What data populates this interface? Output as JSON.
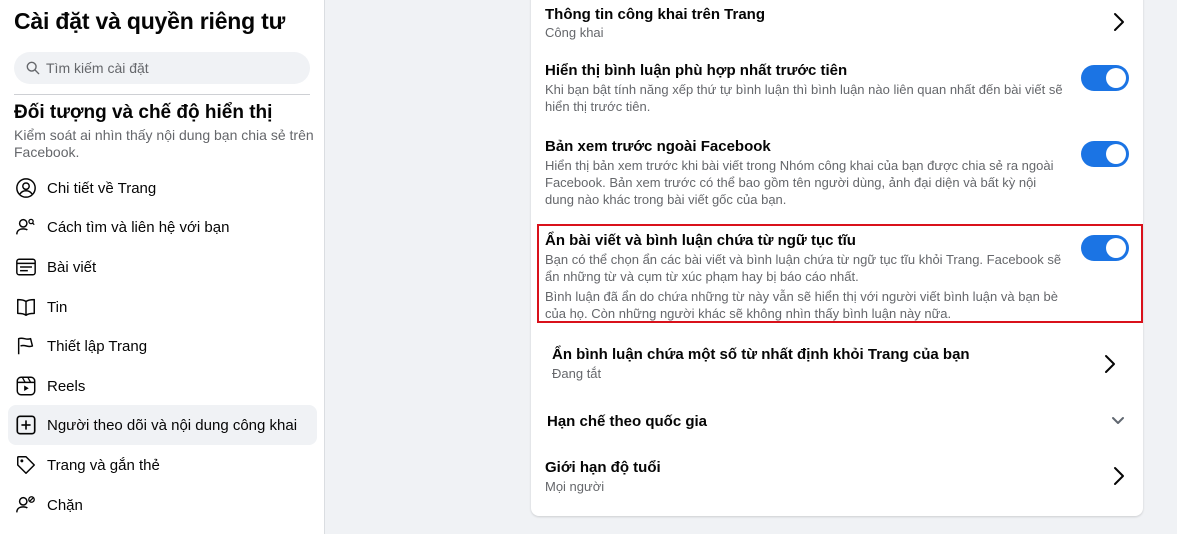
{
  "sidebar": {
    "title": "Cài đặt và quyền riêng tư",
    "search_placeholder": "Tìm kiếm cài đặt",
    "section_title": "Đối tượng và chế độ hiển thị",
    "section_desc": "Kiểm soát ai nhìn thấy nội dung bạn chia sẻ trên Facebook.",
    "items": [
      {
        "label": "Chi tiết về Trang",
        "icon": "profile-icon"
      },
      {
        "label": "Cách tìm và liên hệ với bạn",
        "icon": "find-people-icon"
      },
      {
        "label": "Bài viết",
        "icon": "posts-icon"
      },
      {
        "label": "Tin",
        "icon": "book-icon"
      },
      {
        "label": "Thiết lập Trang",
        "icon": "flag-icon"
      },
      {
        "label": "Reels",
        "icon": "reels-icon"
      },
      {
        "label": "Người theo dõi và nội dung công khai",
        "icon": "plus-square-icon",
        "active": true
      },
      {
        "label": "Trang và gắn thẻ",
        "icon": "tag-icon"
      },
      {
        "label": "Chặn",
        "icon": "block-user-icon"
      }
    ]
  },
  "main": {
    "public_info": {
      "title": "Thông tin công khai trên Trang",
      "value": "Công khai"
    },
    "relevant_comments": {
      "title": "Hiển thị bình luận phù hợp nhất trước tiên",
      "desc": "Khi bạn bật tính năng xếp thứ tự bình luận thì bình luận nào liên quan nhất đến bài viết sẽ hiển thị trước tiên.",
      "enabled": true
    },
    "preview_outside": {
      "title": "Bản xem trước ngoài Facebook",
      "desc": "Hiển thị bản xem trước khi bài viết trong Nhóm công khai của bạn được chia sẻ ra ngoài Facebook. Bản xem trước có thể bao gồm tên người dùng, ảnh đại diện và bất kỳ nội dung nào khác trong bài viết gốc của bạn.",
      "enabled": true
    },
    "hide_profanity": {
      "title": "Ẩn bài viết và bình luận chứa từ ngữ tục tĩu",
      "desc1": "Bạn có thể chọn ẩn các bài viết và bình luận chứa từ ngữ tục tĩu khỏi Trang. Facebook sẽ ẩn những từ và cụm từ xúc phạm hay bị báo cáo nhất.",
      "desc2": "Bình luận đã ẩn do chứa những từ này vẫn sẽ hiển thị với người viết bình luận và bạn bè của họ. Còn những người khác sẽ không nhìn thấy bình luận này nữa.",
      "enabled": true
    },
    "hide_words": {
      "title": "Ẩn bình luận chứa một số từ nhất định khỏi Trang của bạn",
      "value": "Đang tắt"
    },
    "country_restrict": {
      "title": "Hạn chế theo quốc gia"
    },
    "age_limit": {
      "title": "Giới hạn độ tuổi",
      "value": "Mọi người"
    }
  },
  "colors": {
    "accent": "#1b74e4",
    "highlight": "#d9111b"
  }
}
